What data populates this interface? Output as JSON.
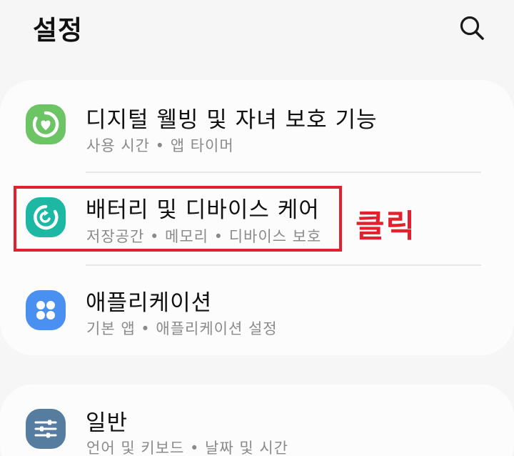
{
  "header": {
    "title": "설정",
    "search_icon": "search-icon"
  },
  "groups": [
    {
      "items": [
        {
          "id": "wellbeing",
          "title": "디지털 웰빙 및 자녀 보호 기능",
          "subtitle": "사용 시간 • 앱 타이머",
          "icon": "heart-ring-icon",
          "icon_color": "#6cc465"
        },
        {
          "id": "battery",
          "title": "배터리 및 디바이스 케어",
          "subtitle": "저장공간 • 메모리 • 디바이스 보호",
          "icon": "device-care-icon",
          "icon_color": "#1cb8a4"
        },
        {
          "id": "apps",
          "title": "애플리케이션",
          "subtitle": "기본 앱 • 애플리케이션 설정",
          "icon": "apps-grid-icon",
          "icon_color": "#4a90f0"
        }
      ]
    },
    {
      "items": [
        {
          "id": "general",
          "title": "일반",
          "subtitle": "언어 및 키보드 • 날짜 및 시간",
          "icon": "sliders-icon",
          "icon_color": "#567da0"
        }
      ]
    }
  ],
  "annotation": {
    "label": "클릭",
    "color": "#e3202e"
  }
}
